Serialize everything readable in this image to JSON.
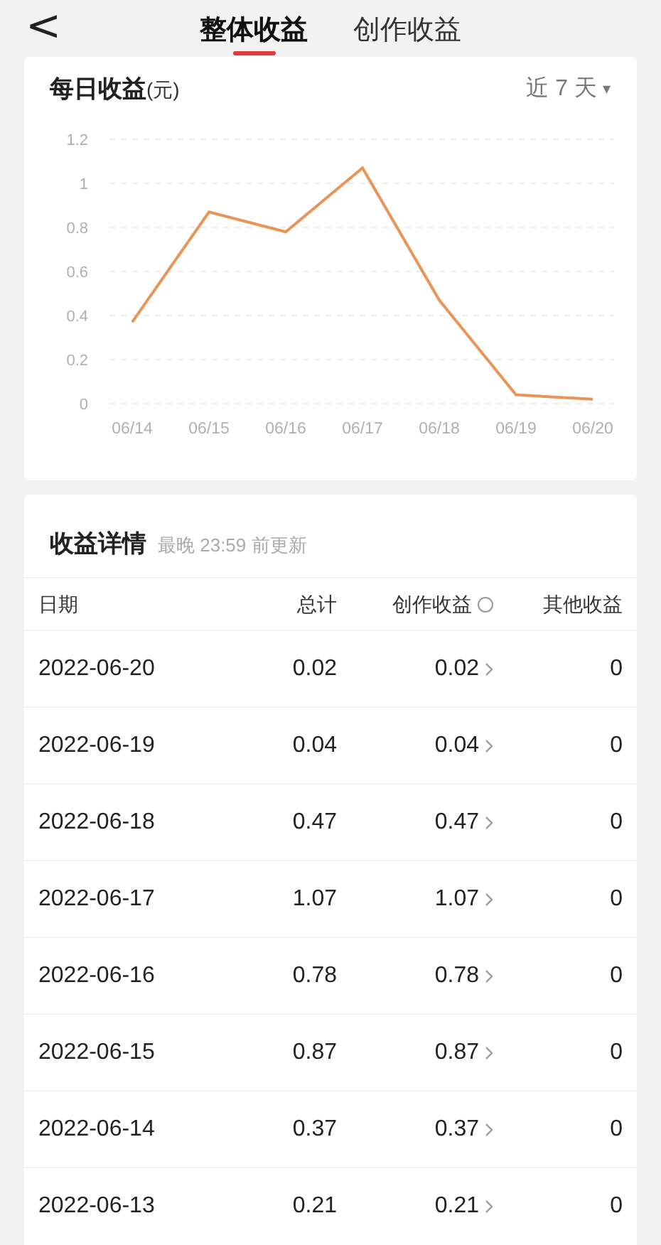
{
  "header": {
    "back": "<",
    "tabs": [
      {
        "label": "整体收益",
        "selected": true
      },
      {
        "label": "创作收益",
        "selected": false
      }
    ]
  },
  "daily": {
    "title": "每日收益",
    "unit": "(元)",
    "range": "近 7 天",
    "range_caret": "▾",
    "chart_data": {
      "type": "line",
      "categories": [
        "06/14",
        "06/15",
        "06/16",
        "06/17",
        "06/18",
        "06/19",
        "06/20"
      ],
      "grid": true,
      "series": [
        {
          "color": "#e8955a",
          "values": [
            0.37,
            0.87,
            0.78,
            1.07,
            0.47,
            0.04,
            0.02
          ]
        }
      ],
      "ylim": [
        0,
        1.2
      ],
      "yticks": [
        0,
        {
          "value": 0.2,
          "label": "0.2"
        },
        {
          "value": 0.4,
          "label": "0.4"
        },
        {
          "value": 0.6,
          "label": "0.6"
        },
        {
          "value": 0.8,
          "label": "0.8"
        },
        1,
        {
          "value": 1.2,
          "label": "1.2"
        }
      ]
    }
  },
  "details": {
    "title": "收益详情",
    "note": "最晚 23:59 前更新",
    "columns": [
      "日期",
      "总计",
      "创作收益",
      "其他收益"
    ],
    "rows": [
      {
        "date": "2022-06-20",
        "total": "0.02",
        "creation": "0.02",
        "other": "0"
      },
      {
        "date": "2022-06-19",
        "total": "0.04",
        "creation": "0.04",
        "other": "0"
      },
      {
        "date": "2022-06-18",
        "total": "0.47",
        "creation": "0.47",
        "other": "0"
      },
      {
        "date": "2022-06-17",
        "total": "1.07",
        "creation": "1.07",
        "other": "0"
      },
      {
        "date": "2022-06-16",
        "total": "0.78",
        "creation": "0.78",
        "other": "0"
      },
      {
        "date": "2022-06-15",
        "total": "0.87",
        "creation": "0.87",
        "other": "0"
      },
      {
        "date": "2022-06-14",
        "total": "0.37",
        "creation": "0.37",
        "other": "0"
      },
      {
        "date": "2022-06-13",
        "total": "0.21",
        "creation": "0.21",
        "other": "0"
      }
    ]
  }
}
